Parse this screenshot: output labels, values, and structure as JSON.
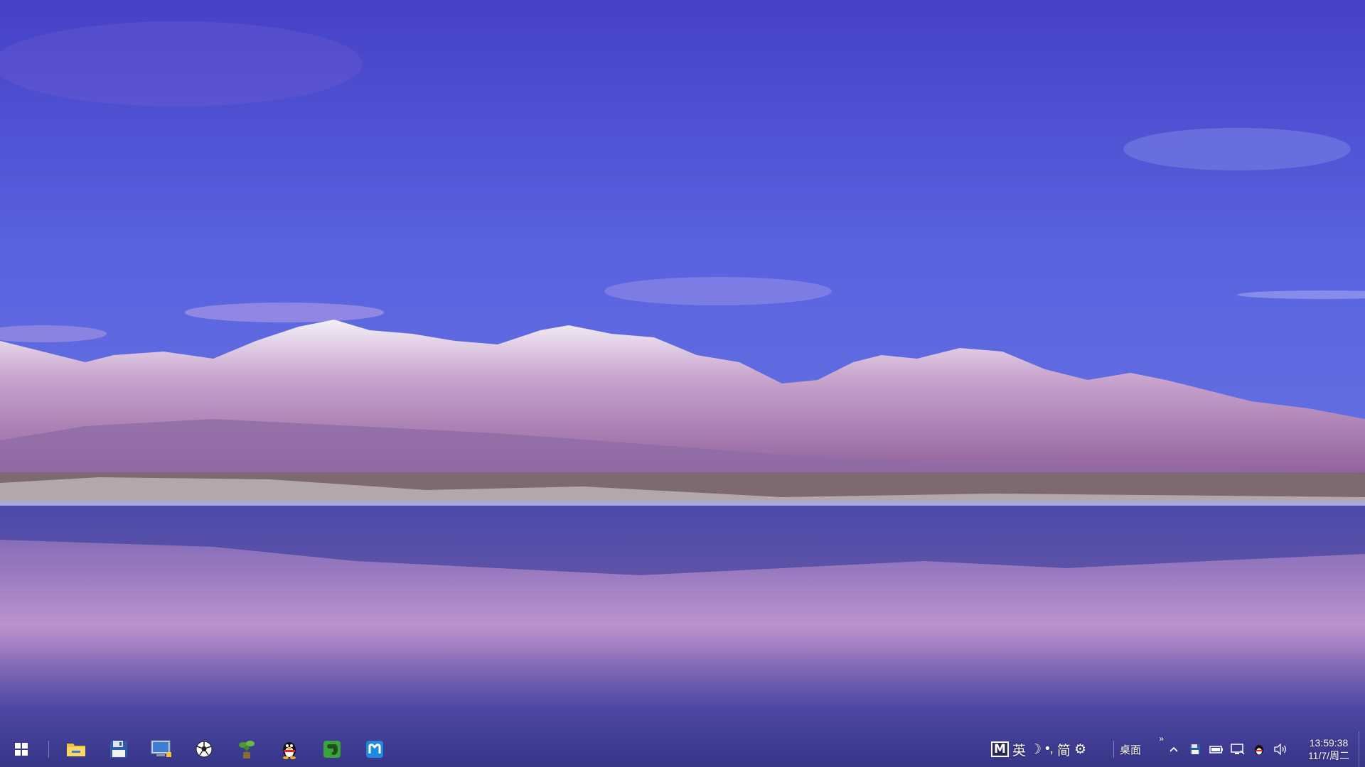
{
  "wallpaper": {
    "description_icon": "mountain-lake-wallpaper",
    "sky_top": "#4a48cd",
    "sky_mid": "#5d66e2",
    "snow": "#f2eef7",
    "mountain": "#a47ab8",
    "water": "#4e4aa8",
    "reflection": "#c79ad0"
  },
  "taskbar": {
    "start_icon": "windows-logo-icon",
    "pinned_apps": [
      {
        "id": "file-explorer",
        "icon": "folder-icon"
      },
      {
        "id": "save-app",
        "icon": "floppy-disk-icon"
      },
      {
        "id": "this-pc",
        "icon": "computer-icon"
      },
      {
        "id": "soccer-game",
        "icon": "soccer-ball-icon"
      },
      {
        "id": "plant-app",
        "icon": "plant-icon"
      },
      {
        "id": "qq",
        "icon": "penguin-icon"
      },
      {
        "id": "evernote",
        "icon": "elephant-icon"
      },
      {
        "id": "maxthon",
        "icon": "maxthon-icon"
      }
    ]
  },
  "ime": {
    "logo": "M",
    "lang": "英",
    "moon": "☽",
    "punct": "•,",
    "simplified": "简",
    "gear": "⚙"
  },
  "tray": {
    "desktop_label": "桌面",
    "double_chevron": "»",
    "up_chevron": "^",
    "icons": [
      "floppy-tray-icon",
      "battery-icon",
      "network-icon",
      "qq-tray-icon",
      "volume-icon"
    ]
  },
  "clock": {
    "time": "13:59:38",
    "date": "11/7/周二"
  }
}
